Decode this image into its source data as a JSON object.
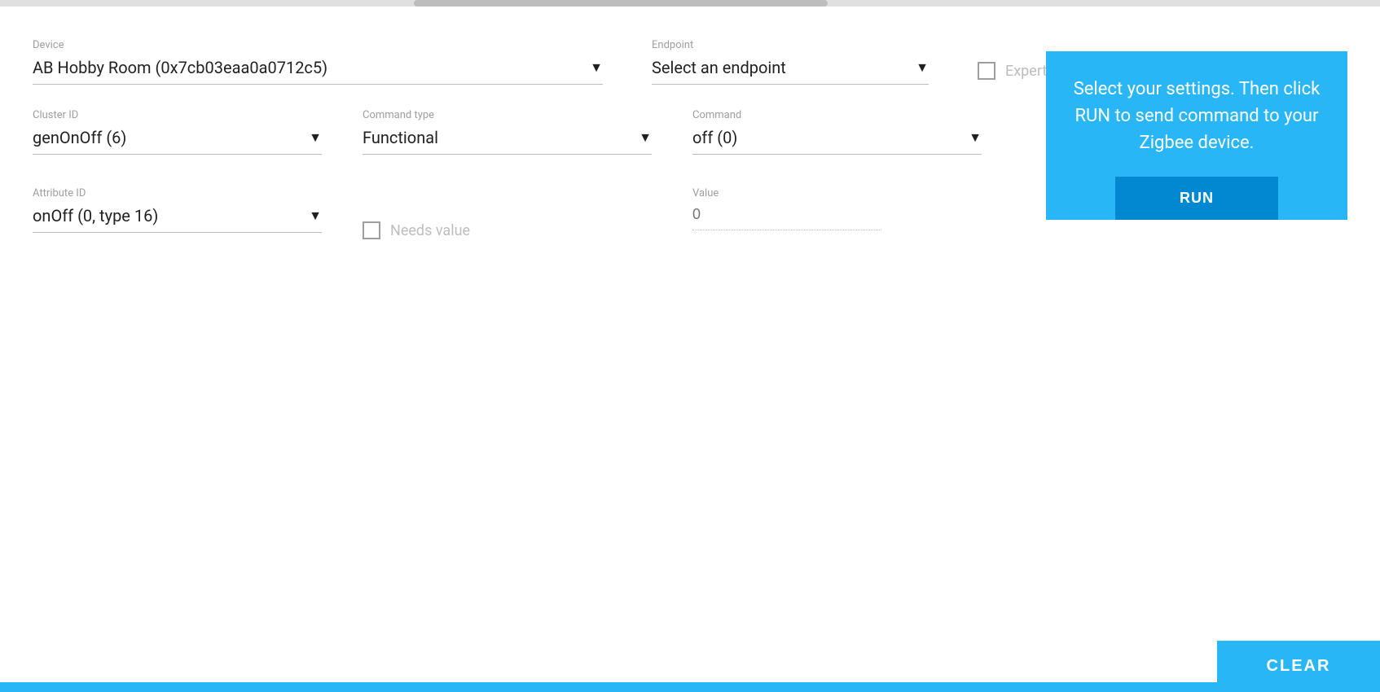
{
  "topScrollbar": {},
  "device": {
    "label": "Device",
    "value": "AB Hobby Room (0x7cb03eaa0a0712c5)",
    "arrow": "▼"
  },
  "endpoint": {
    "label": "Endpoint",
    "value": "Select an endpoint",
    "arrow": "▼"
  },
  "expertMode": {
    "label": "Expert mode"
  },
  "clusterId": {
    "label": "Cluster ID",
    "value": "genOnOff (6)",
    "arrow": "▼"
  },
  "commandType": {
    "label": "Command type",
    "value": "Functional",
    "arrow": "▼"
  },
  "command": {
    "label": "Command",
    "value": "off (0)",
    "arrow": "▼"
  },
  "bluePanel": {
    "text": "Select your settings. Then click RUN to send command to your Zigbee device.",
    "runLabel": "RUN"
  },
  "attributeId": {
    "label": "Attribute ID",
    "value": "onOff (0, type 16)",
    "arrow": "▼"
  },
  "needsValue": {
    "label": "Needs value"
  },
  "value": {
    "label": "Value",
    "placeholder": "0"
  },
  "clearButton": {
    "label": "CLEAR"
  }
}
